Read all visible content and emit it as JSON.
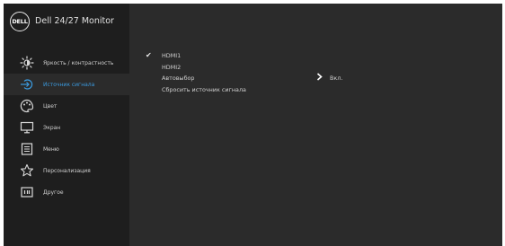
{
  "header": {
    "logo_text": "DELL",
    "model": "Dell 24/27 Monitor"
  },
  "sidebar": {
    "items": [
      {
        "label": "Яркость / контрастность",
        "icon": "brightness-icon"
      },
      {
        "label": "Источник сигнала",
        "icon": "input-source-icon",
        "active": true
      },
      {
        "label": "Цвет",
        "icon": "color-icon"
      },
      {
        "label": "Экран",
        "icon": "display-icon"
      },
      {
        "label": "Меню",
        "icon": "menu-icon"
      },
      {
        "label": "Персонализация",
        "icon": "star-icon"
      },
      {
        "label": "Другое",
        "icon": "other-icon"
      }
    ]
  },
  "main": {
    "options": [
      {
        "label": "HDMI1",
        "checked": true
      },
      {
        "label": "HDMI2"
      },
      {
        "label": "Автовыбор",
        "value": "Вкл.",
        "has_arrow": true
      },
      {
        "label": "Сбросить источник сигнала"
      }
    ]
  },
  "colors": {
    "accent": "#3b9be0",
    "sidebar_bg": "#1e1e1e",
    "main_bg": "#2b2b2b"
  }
}
